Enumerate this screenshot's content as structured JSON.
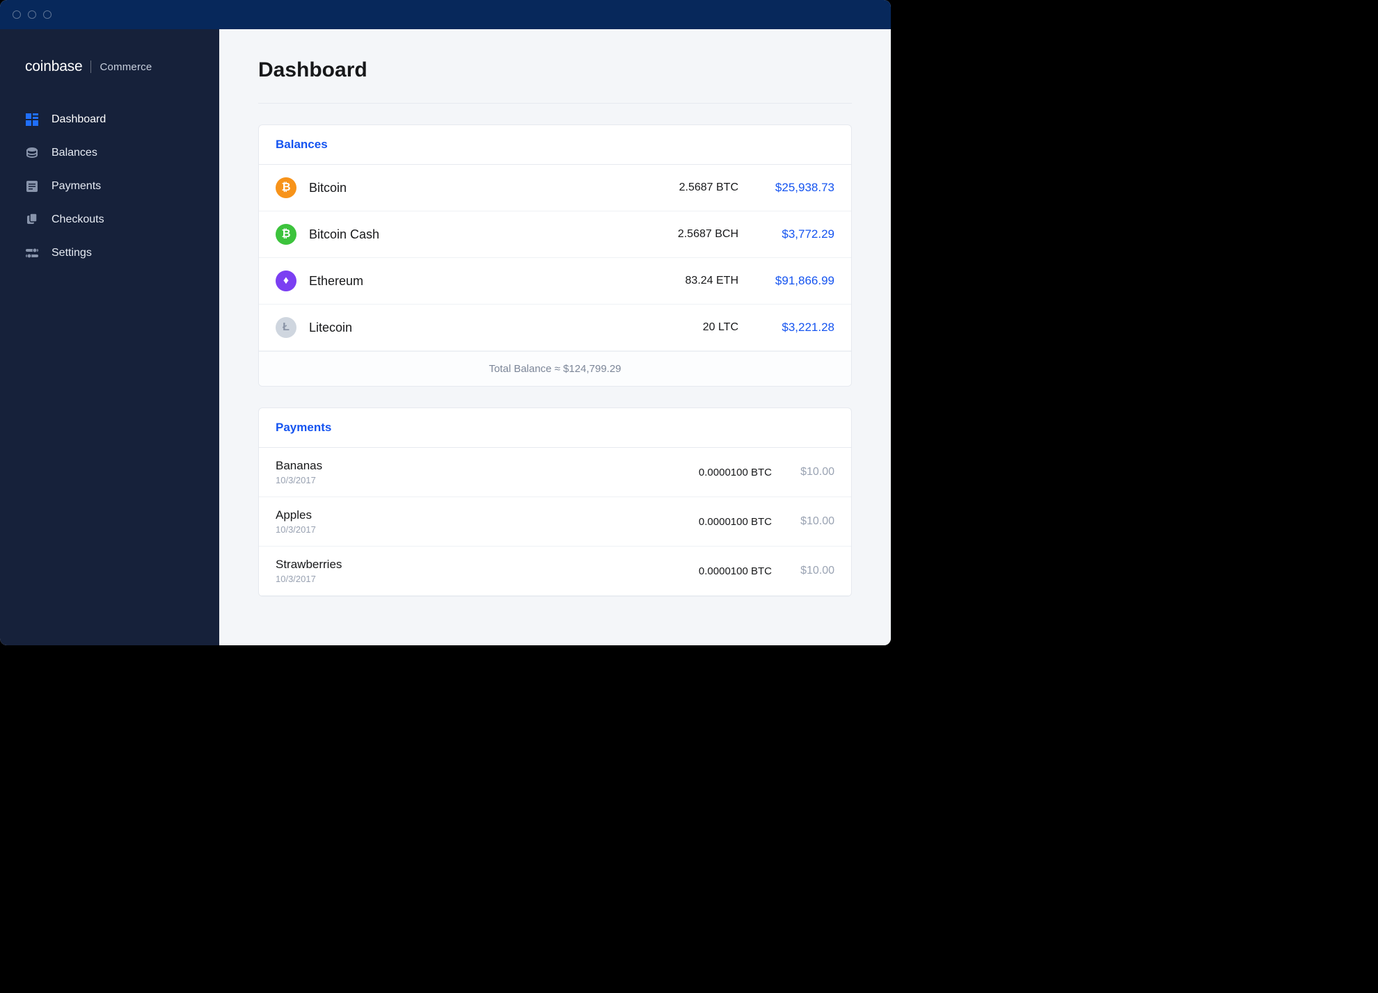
{
  "brand": {
    "main": "coinbase",
    "sub": "Commerce"
  },
  "nav": {
    "items": [
      {
        "label": "Dashboard"
      },
      {
        "label": "Balances"
      },
      {
        "label": "Payments"
      },
      {
        "label": "Checkouts"
      },
      {
        "label": "Settings"
      }
    ]
  },
  "page": {
    "title": "Dashboard"
  },
  "balances": {
    "heading": "Balances",
    "rows": [
      {
        "name": "Bitcoin",
        "amount": "2.5687 BTC",
        "usd": "$25,938.73",
        "color": "#f7931a",
        "glyph": "₿"
      },
      {
        "name": "Bitcoin Cash",
        "amount": "2.5687 BCH",
        "usd": "$3,772.29",
        "color": "#3cc33c",
        "glyph": "₿"
      },
      {
        "name": "Ethereum",
        "amount": "83.24 ETH",
        "usd": "$91,866.99",
        "color": "#7b3ff2",
        "glyph": "♦"
      },
      {
        "name": "Litecoin",
        "amount": "20 LTC",
        "usd": "$3,221.28",
        "color": "#cfd6df",
        "glyph": "Ł"
      }
    ],
    "total_label": "Total Balance ≈ $124,799.29"
  },
  "payments": {
    "heading": "Payments",
    "rows": [
      {
        "item": "Bananas",
        "date": "10/3/2017",
        "amount": "0.0000100 BTC",
        "usd": "$10.00"
      },
      {
        "item": "Apples",
        "date": "10/3/2017",
        "amount": "0.0000100 BTC",
        "usd": "$10.00"
      },
      {
        "item": "Strawberries",
        "date": "10/3/2017",
        "amount": "0.0000100 BTC",
        "usd": "$10.00"
      }
    ]
  }
}
